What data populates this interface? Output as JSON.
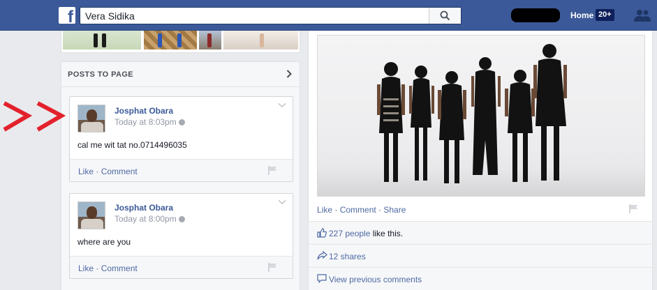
{
  "topbar": {
    "logo_letter": "f",
    "search_value": "Vera Sidika",
    "home_label": "Home",
    "home_badge": "20+"
  },
  "left": {
    "panel_title": "POSTS TO PAGE",
    "posts": [
      {
        "author": "Josphat Obara",
        "timestamp": "Today at 8:03pm",
        "text": "cal me wit tat no.0714496035",
        "like": "Like",
        "sep": " · ",
        "comment": "Comment"
      },
      {
        "author": "Josphat Obara",
        "timestamp": "Today at 8:00pm",
        "text": "where are you",
        "like": "Like",
        "sep": " · ",
        "comment": "Comment"
      }
    ]
  },
  "right": {
    "actions": {
      "like": "Like",
      "sep": " · ",
      "comment": "Comment",
      "share": "Share"
    },
    "likes_count": "227 people",
    "likes_suffix": " like this.",
    "shares": "12 shares",
    "view_previous": "View previous comments"
  },
  "colors": {
    "brand": "#3b5998",
    "link": "#4e69a2",
    "annotation_arrow": "#e3212c"
  }
}
